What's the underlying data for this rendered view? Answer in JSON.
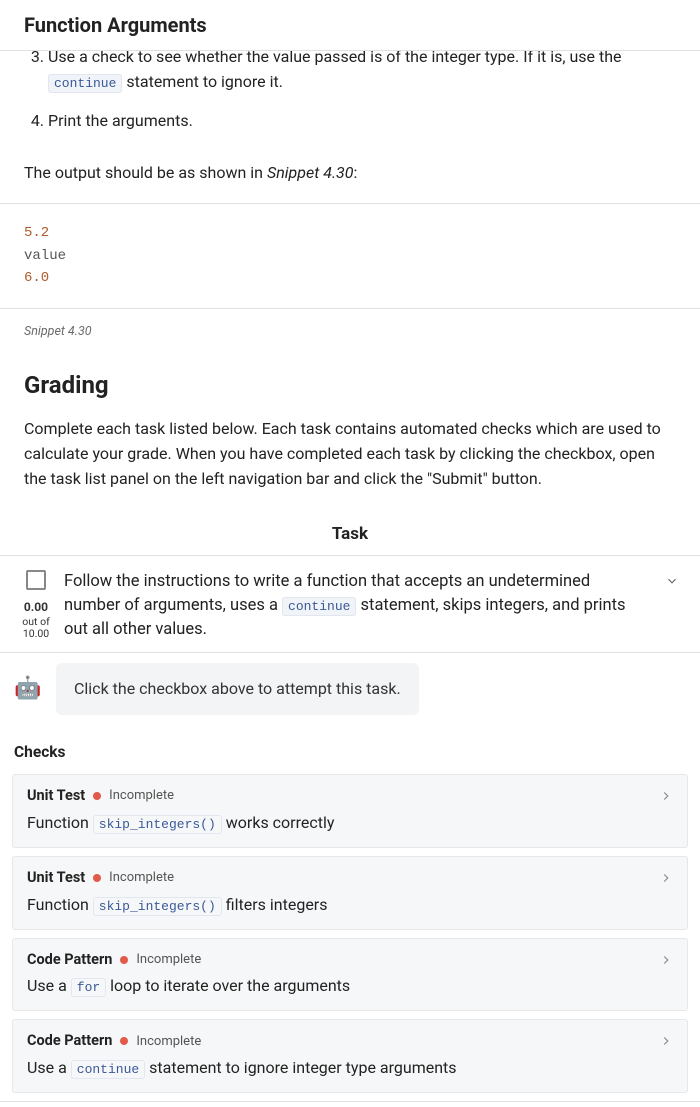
{
  "header": {
    "title": "Function Arguments"
  },
  "steps": {
    "s3_pre": "Use a check to see whether the value passed is of the integer type. If it is, use the ",
    "s3_code": "continue",
    "s3_post": " statement to ignore it.",
    "s4": "Print the arguments."
  },
  "intro": {
    "pre": "The output should be as shown in ",
    "em": "Snippet 4.30",
    "post": ":"
  },
  "snippet": {
    "l1": "5.2",
    "l2": "value",
    "l3": "6.0",
    "caption": "Snippet 4.30"
  },
  "grading": {
    "heading": "Grading",
    "text": "Complete each task listed below. Each task contains automated checks which are used to calculate your grade. When you have completed each task by clicking the checkbox, open the task list panel on the left navigation bar and click the \"Submit\" button."
  },
  "task": {
    "header": "Task",
    "score_num": "0.00",
    "score_label1": "out of",
    "score_label2": "10.00",
    "body_pre": "Follow the instructions to write a function that accepts an undetermined number of arguments, uses a ",
    "body_code": "continue",
    "body_post": " statement, skips integers, and prints out all other values.",
    "hint": "Click the checkbox above to attempt this task."
  },
  "checks": {
    "heading": "Checks",
    "status_label": "Incomplete",
    "items": [
      {
        "kind": "Unit Test",
        "desc_pre": "Function ",
        "desc_code": "skip_integers()",
        "desc_post": " works correctly"
      },
      {
        "kind": "Unit Test",
        "desc_pre": "Function ",
        "desc_code": "skip_integers()",
        "desc_post": " filters integers"
      },
      {
        "kind": "Code Pattern",
        "desc_pre": "Use a ",
        "desc_code": "for",
        "desc_post": " loop to iterate over the arguments"
      },
      {
        "kind": "Code Pattern",
        "desc_pre": "Use a ",
        "desc_code": "continue",
        "desc_post": " statement to ignore integer type arguments"
      }
    ]
  }
}
